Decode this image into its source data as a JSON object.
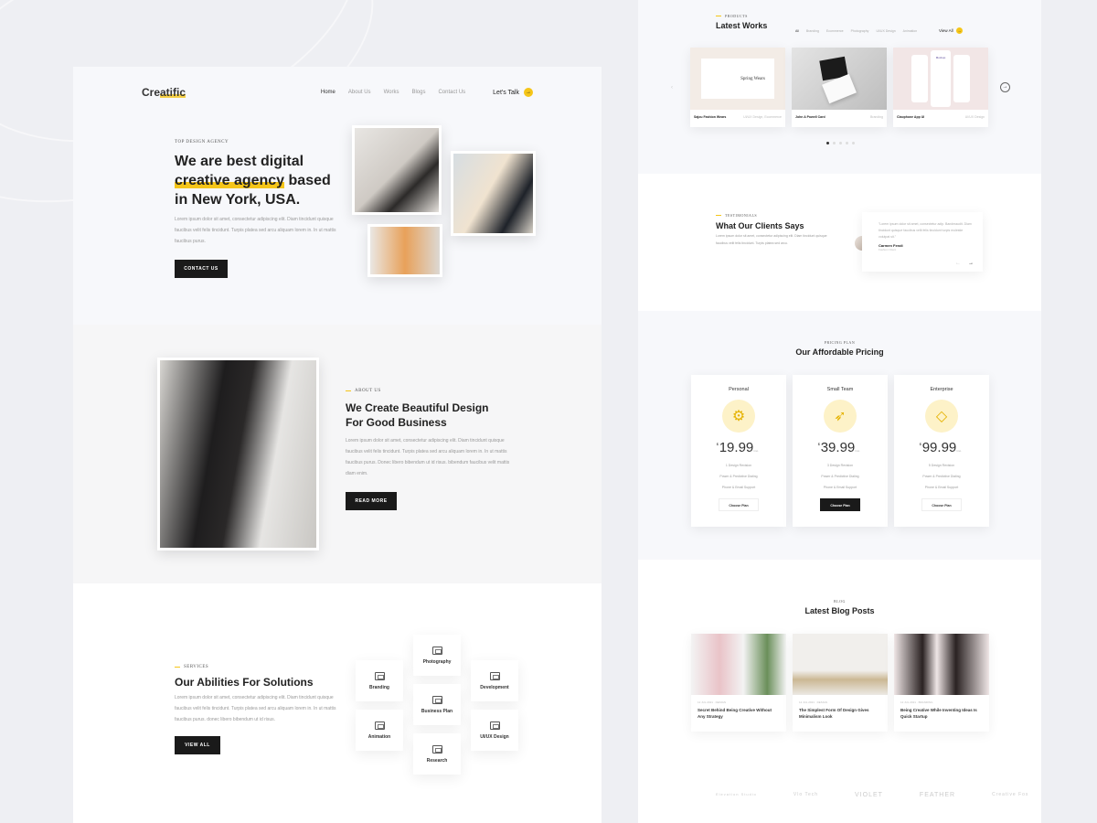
{
  "left_page": {
    "nav": {
      "logo": "Creatific",
      "menu": [
        "Home",
        "About Us",
        "Works",
        "Blogs",
        "Contact Us"
      ],
      "cta": "Let's Talk"
    },
    "hero": {
      "eyebrow": "Top Design Agency",
      "title_line1": "We are best digital",
      "title_mark": "creative agency",
      "title_after_mark": " based",
      "title_line3": "in New York, USA.",
      "text": "Lorem ipsum dolor sit amet, consectetur adipiscing elit. Diam tincidunt quisque faucibus velit felis tincidunt. Turpis platea sed arcu aliquam lorem in. In ut mattis faucibus purus.",
      "button": "Contact Us"
    },
    "about": {
      "eyebrow": "About Us",
      "title_line1": "We Create Beautiful Design",
      "title_line2": "For Good Business",
      "text": "Lorem ipsum dolor sit amet, consectetur adipiscing elit. Diam tincidunt quisque faucibus velit felis tincidunt. Turpis platea sed arcu aliquam lorem in. In ut mattis faucibus purus. Donec libero bibendum ut id risus. bibendum faucibus velit mattis diam enim.",
      "button": "Read More"
    },
    "services": {
      "eyebrow": "Services",
      "title": "Our Abilities For Solutions",
      "text": "Lorem ipsum dolor sit amet, consectetur adipiscing elit. Diam tincidunt quisque faucibus velit felis tincidunt. Turpis platea sed arcu aliquam lorem in. In ut mattis faucibus purus. donec libero bibendum ut id risus.",
      "button": "View All",
      "items": [
        "Photography",
        "Branding",
        "Development",
        "Business Plan",
        "Animation",
        "UI/UX Design",
        "Research"
      ]
    }
  },
  "right_page": {
    "works": {
      "eyebrow": "Products",
      "title": "Latest Works",
      "tabs": [
        "All",
        "Branding",
        "Ecommerce",
        "Photography",
        "UI/UX Design",
        "Animation"
      ],
      "view_all": "View All",
      "cards": [
        {
          "title": "Sajou Fashion Wears",
          "tag": "UI/UX Design, Ecommerce",
          "image_text": "Spring Wears"
        },
        {
          "title": "John A Powell Card",
          "tag": "Branding",
          "image_text": ""
        },
        {
          "title": "Claophone App UI",
          "tag": "UI/UX Design",
          "image_text": "Mockup"
        }
      ],
      "pager_count": 5,
      "pager_active": 1
    },
    "testimonials": {
      "eyebrow": "Testimonials",
      "title": "What Our Clients Says",
      "text": "Lorem ipsum dolor sit amet, consectetur adipiscing elit. Diam tincidunt quisque faucibus velit felis tincidunt. Turpis platea sed arcu.",
      "quote": "\"Lorem ipsum dolor sit amet, consectetur adip. Bandmaudit. Diam tincidunt quisque faucibus velit felis tincidunt turpis molestie volutpat sit.\"",
      "name": "Carmen Fendi",
      "role": "Fashion Client"
    },
    "pricing": {
      "eyebrow": "Pricing Plan",
      "title": "Our Affordable Pricing",
      "plans": [
        {
          "name": "Personal",
          "icon": "gear-icon",
          "currency": "$",
          "price": "19.99",
          "period": "/mo",
          "features": [
            "1 Design Revision",
            "Power & Predictive Dialing",
            "Phone & Email Support"
          ],
          "button": "Choose Plan",
          "highlight": false
        },
        {
          "name": "Small Team",
          "icon": "rocket-icon",
          "currency": "$",
          "price": "39.99",
          "period": "/mo",
          "features": [
            "3 Design Revision",
            "Power & Predictive Dialing",
            "Phone & Email Support"
          ],
          "button": "Choose Plan",
          "highlight": true
        },
        {
          "name": "Enterprise",
          "icon": "diamond-icon",
          "currency": "$",
          "price": "99.99",
          "period": "/mo",
          "features": [
            "5 Design Revision",
            "Power & Predictive Dialing",
            "Phone & Email Support"
          ],
          "button": "Choose Plan",
          "highlight": false
        }
      ]
    },
    "blog": {
      "eyebrow": "Blog",
      "title": "Latest Blog Posts",
      "posts": [
        {
          "meta": "12 JUL 2021 · DESIGN",
          "title": "Secret Behind Being Creative Without Any Strategy"
        },
        {
          "meta": "12 JUL 2021 · DESIGN",
          "title": "The Simplest Form Of Design Gives Minimalism Look"
        },
        {
          "meta": "12 JUL 2021 · BRANDING",
          "title": "Being Creative While Inventing Ideas Is Quick Startup"
        }
      ]
    },
    "brands": [
      "Elevation Studio",
      "Vlo Tech",
      "VIOLET",
      "FEATHER",
      "Creative Fox"
    ]
  }
}
